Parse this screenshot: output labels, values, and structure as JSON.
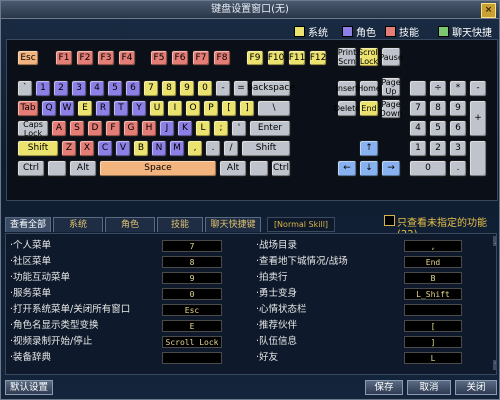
{
  "window": {
    "title": "键盘设置窗口(无)",
    "close": "×"
  },
  "legend": [
    {
      "label": "系统",
      "color": "#ece36e"
    },
    {
      "label": "角色",
      "color": "#8c80e6"
    },
    {
      "label": "技能",
      "color": "#e37d76"
    },
    {
      "label": "聊天快捷键",
      "color": "#7cc870"
    }
  ],
  "keys": {
    "esc": "Esc",
    "f1": "F1",
    "f2": "F2",
    "f3": "F3",
    "f4": "F4",
    "f5": "F5",
    "f6": "F6",
    "f7": "F7",
    "f8": "F8",
    "f9": "F9",
    "f10": "F10",
    "f11": "F11",
    "f12": "F12",
    "printscrn": "Print Scrn",
    "scrolllock": "Scroll Lock",
    "pause": "Pause",
    "backquote": "`",
    "n1": "1",
    "n2": "2",
    "n3": "3",
    "n4": "4",
    "n5": "5",
    "n6": "6",
    "n7": "7",
    "n8": "8",
    "n9": "9",
    "n0": "0",
    "minus": "-",
    "equal": "=",
    "backspace": "backspace",
    "insert": "Insert",
    "home": "Home",
    "pageup": "Page Up",
    "numlock": "",
    "numdiv": "÷",
    "nummul": "*",
    "numsub": "-",
    "tab": "Tab",
    "q": "Q",
    "w": "W",
    "e": "E",
    "r": "R",
    "t": "T",
    "y": "Y",
    "u": "U",
    "i": "I",
    "o": "O",
    "p": "P",
    "lbracket": "[",
    "rbracket": "]",
    "backslash": "\\",
    "delete": "Delete",
    "end": "End",
    "pagedown": "Page Down",
    "num7": "7",
    "num8": "8",
    "num9": "9",
    "numadd": "+",
    "capslock": "Caps Lock",
    "a": "A",
    "s": "S",
    "d": "D",
    "f": "F",
    "g": "G",
    "h": "H",
    "j": "J",
    "k": "K",
    "l": "L",
    "semicolon": ";",
    "quote": "'",
    "enter": "Enter",
    "num4": "4",
    "num5": "5",
    "num6": "6",
    "lshift": "Shift",
    "z": "Z",
    "x": "X",
    "c": "C",
    "v": "V",
    "b": "B",
    "n": "N",
    "m": "M",
    "comma": ",",
    "period": ".",
    "slash": "/",
    "rshift": "Shift",
    "up": "↑",
    "num1": "1",
    "num2": "2",
    "num3": "3",
    "numenter": "",
    "lctrl": "Ctrl",
    "lalt": "Alt",
    "space": "Space",
    "ralt": "Alt",
    "rctrl": "Ctrl",
    "left": "←",
    "down": "↓",
    "right": "→",
    "num0": "0",
    "numdot": "."
  },
  "tabs": [
    "查看全部",
    "系统",
    "角色",
    "技能",
    "聊天快捷键"
  ],
  "keyboard_name": "[Normal Skill]",
  "filter": {
    "label": "只查看未指定的功能(22)",
    "checked": false
  },
  "shortcuts_left": [
    {
      "label": "·个人菜单",
      "key": "7"
    },
    {
      "label": "·社区菜单",
      "key": "8"
    },
    {
      "label": "·功能互动菜单",
      "key": "9"
    },
    {
      "label": "·服务菜单",
      "key": "0"
    },
    {
      "label": "·打开系统菜单/关闭所有窗口",
      "key": "Esc"
    },
    {
      "label": "·角色名显示类型变换",
      "key": "E"
    },
    {
      "label": "·视频录制开始/停止",
      "key": "Scroll Lock"
    },
    {
      "label": "·装备辞典",
      "key": ""
    }
  ],
  "shortcuts_right": [
    {
      "label": "·战场目录",
      "key": ","
    },
    {
      "label": "·查看地下城情况/战场",
      "key": "End"
    },
    {
      "label": "·拍卖行",
      "key": "B"
    },
    {
      "label": "·勇士变身",
      "key": "L_Shift"
    },
    {
      "label": "·心情状态栏",
      "key": ""
    },
    {
      "label": "·推荐伙伴",
      "key": "["
    },
    {
      "label": "·队伍信息",
      "key": "]"
    },
    {
      "label": "·好友",
      "key": "L"
    }
  ],
  "buttons": {
    "default": "默认设置",
    "save": "保存",
    "cancel": "取消",
    "close": "关闭"
  }
}
